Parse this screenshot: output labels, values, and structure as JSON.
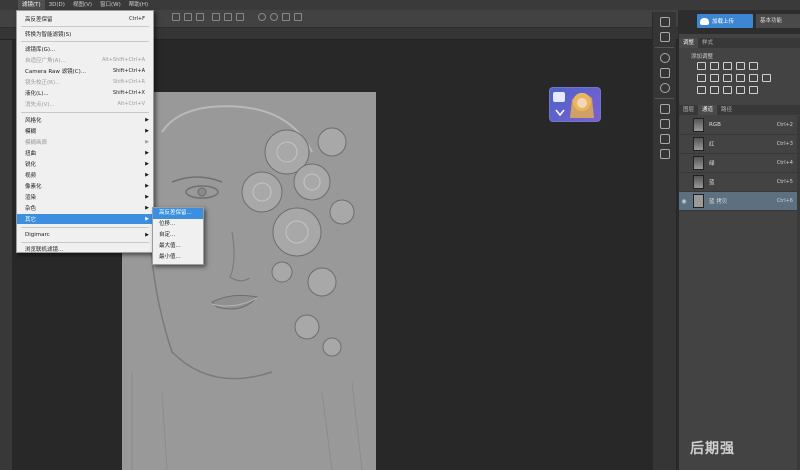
{
  "menubar": [
    "滤镜(T)",
    "3D(D)",
    "视图(V)",
    "窗口(W)",
    "帮助(H)"
  ],
  "filter_menu": [
    {
      "label": "高反差保留",
      "shortcut": "Ctrl+F",
      "disabled": false
    },
    {
      "label": "转换为智能滤镜(S)",
      "shortcut": "",
      "disabled": false
    },
    {
      "label": "滤镜库(G)...",
      "shortcut": "",
      "disabled": false
    },
    {
      "label": "自适应广角(A)...",
      "shortcut": "Alt+Shift+Ctrl+A",
      "disabled": true
    },
    {
      "label": "Camera Raw 滤镜(C)...",
      "shortcut": "Shift+Ctrl+A",
      "disabled": false
    },
    {
      "label": "镜头校正(R)...",
      "shortcut": "Shift+Ctrl+R",
      "disabled": true
    },
    {
      "label": "液化(L)...",
      "shortcut": "Shift+Ctrl+X",
      "disabled": false
    },
    {
      "label": "消失点(V)...",
      "shortcut": "Alt+Ctrl+V",
      "disabled": true
    },
    {
      "label": "风格化",
      "arrow": true
    },
    {
      "label": "模糊",
      "arrow": true
    },
    {
      "label": "模糊画廊",
      "arrow": true,
      "disabled": true
    },
    {
      "label": "扭曲",
      "arrow": true
    },
    {
      "label": "锐化",
      "arrow": true
    },
    {
      "label": "视频",
      "arrow": true
    },
    {
      "label": "像素化",
      "arrow": true
    },
    {
      "label": "渲染",
      "arrow": true
    },
    {
      "label": "杂色",
      "arrow": true
    },
    {
      "label": "其它",
      "arrow": true,
      "highlighted": true
    },
    {
      "label": "Digimarc",
      "arrow": true
    },
    {
      "label": "浏览联机滤镜...",
      "shortcut": ""
    }
  ],
  "submenu": [
    {
      "label": "高反差保留...",
      "highlighted": true
    },
    {
      "label": "位移..."
    },
    {
      "label": "自定..."
    },
    {
      "label": "最大值..."
    },
    {
      "label": "最小值..."
    }
  ],
  "top_buttons": {
    "cloud": "加载上传",
    "basic": "基本功能"
  },
  "adjust_panel": {
    "tabs": [
      "调整",
      "样式"
    ],
    "title": "添加调整"
  },
  "channels_panel": {
    "tabs": [
      "图层",
      "通道",
      "路径"
    ],
    "channels": [
      {
        "name": "RGB",
        "shortcut": "Ctrl+2"
      },
      {
        "name": "红",
        "shortcut": "Ctrl+3"
      },
      {
        "name": "绿",
        "shortcut": "Ctrl+4"
      },
      {
        "name": "蓝",
        "shortcut": "Ctrl+5"
      },
      {
        "name": "蓝 拷贝",
        "shortcut": "Ctrl+6",
        "selected": true
      }
    ]
  },
  "watermark": "后期强"
}
